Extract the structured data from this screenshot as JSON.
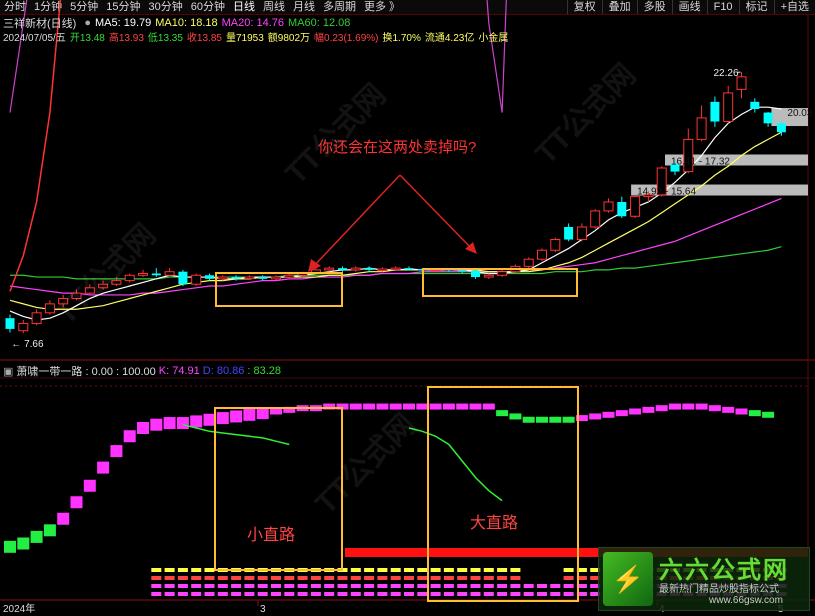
{
  "toolbar": {
    "periods": [
      "分时",
      "1分钟",
      "5分钟",
      "15分钟",
      "30分钟",
      "60分钟",
      "日线",
      "周线",
      "月线",
      "多周期",
      "更多 》"
    ],
    "right_buttons": [
      "复权",
      "叠加",
      "多股",
      "画线",
      "F10",
      "标记",
      "+自选"
    ]
  },
  "main_legend": {
    "title": "三祥新材(日线)",
    "ma5": "MA5: 19.79",
    "ma10": "MA10: 18.18",
    "ma20": "MA20: 14.76",
    "ma60": "MA60: 12.08"
  },
  "info_line": {
    "date": "2024/07/05/五",
    "open": "开13.48",
    "high": "高13.93",
    "low": "低13.35",
    "close": "收13.85",
    "volume": "量71953",
    "amount": "额9802万",
    "change": "幅0.23(1.69%)",
    "turnover": "换1.70%",
    "float_cap": "流通4.23亿",
    "sector": "小金属"
  },
  "price_labels": {
    "high_mark": "22.26",
    "right_mark": "20.03",
    "low_mark": "← 7.66",
    "zone_upper": "16.41 - 17.32",
    "zone_lower": "14.92 - 15.64"
  },
  "annotation": {
    "question": "你还会在这两处卖掉吗?",
    "small_road": "小直路",
    "big_road": "大直路"
  },
  "indicator_legend": {
    "name": "萧啸一带一路 : 0.00 : 100.00",
    "k": "K: 74.91",
    "d": "D: 80.86",
    "j": ": 83.28"
  },
  "x_axis": {
    "year": "2024年",
    "m3": "3",
    "m4": "4",
    "m5": "5"
  },
  "watermark": {
    "logo": "TT公式网",
    "url": "www.66gsw.com",
    "badge_title": "六六公式网",
    "badge_sub": "最新热门精品炒股指标公式",
    "badge_url": "www.66gsw.com"
  },
  "colors": {
    "up": "#ff3333",
    "down": "#00ffff",
    "ma5": "#ffffff",
    "ma10": "#ffff66",
    "ma20": "#ff44ff",
    "ma60": "#33cc33",
    "box": "#ffbb33",
    "arrow": "#dd2222",
    "bar_magenta": "#ff33ff",
    "bar_green": "#22ee44"
  },
  "chart_data": {
    "type": "candlestick",
    "candles": [
      {
        "o": 8.5,
        "c": 7.9,
        "h": 8.7,
        "l": 7.7
      },
      {
        "o": 7.8,
        "c": 8.2,
        "h": 8.4,
        "l": 7.66
      },
      {
        "o": 8.2,
        "c": 8.8,
        "h": 9.0,
        "l": 8.1
      },
      {
        "o": 8.8,
        "c": 9.3,
        "h": 9.5,
        "l": 8.7
      },
      {
        "o": 9.3,
        "c": 9.6,
        "h": 9.8,
        "l": 9.1
      },
      {
        "o": 9.6,
        "c": 9.9,
        "h": 10.1,
        "l": 9.5
      },
      {
        "o": 9.9,
        "c": 10.2,
        "h": 10.4,
        "l": 9.8
      },
      {
        "o": 10.2,
        "c": 10.4,
        "h": 10.6,
        "l": 10.1
      },
      {
        "o": 10.4,
        "c": 10.6,
        "h": 10.8,
        "l": 10.3
      },
      {
        "o": 10.6,
        "c": 10.9,
        "h": 11.0,
        "l": 10.5
      },
      {
        "o": 10.9,
        "c": 11.0,
        "h": 11.2,
        "l": 10.8
      },
      {
        "o": 11.0,
        "c": 10.9,
        "h": 11.3,
        "l": 10.8
      },
      {
        "o": 10.9,
        "c": 11.1,
        "h": 11.3,
        "l": 10.8
      },
      {
        "o": 11.1,
        "c": 10.4,
        "h": 11.2,
        "l": 10.3
      },
      {
        "o": 10.4,
        "c": 10.9,
        "h": 11.0,
        "l": 10.3
      },
      {
        "o": 10.9,
        "c": 10.7,
        "h": 11.0,
        "l": 10.6
      },
      {
        "o": 10.7,
        "c": 10.8,
        "h": 10.9,
        "l": 10.6
      },
      {
        "o": 10.8,
        "c": 10.75,
        "h": 10.9,
        "l": 10.6
      },
      {
        "o": 10.75,
        "c": 10.8,
        "h": 10.9,
        "l": 10.7
      },
      {
        "o": 10.8,
        "c": 10.7,
        "h": 10.9,
        "l": 10.6
      },
      {
        "o": 10.7,
        "c": 10.8,
        "h": 10.9,
        "l": 10.6
      },
      {
        "o": 10.8,
        "c": 10.9,
        "h": 11.0,
        "l": 10.7
      },
      {
        "o": 10.9,
        "c": 11.0,
        "h": 11.1,
        "l": 10.8
      },
      {
        "o": 11.0,
        "c": 11.2,
        "h": 11.3,
        "l": 10.9
      },
      {
        "o": 11.2,
        "c": 11.3,
        "h": 11.4,
        "l": 11.1
      },
      {
        "o": 11.3,
        "c": 11.2,
        "h": 11.4,
        "l": 11.1
      },
      {
        "o": 11.2,
        "c": 11.3,
        "h": 11.4,
        "l": 11.1
      },
      {
        "o": 11.3,
        "c": 11.2,
        "h": 11.4,
        "l": 11.1
      },
      {
        "o": 11.2,
        "c": 11.25,
        "h": 11.35,
        "l": 11.1
      },
      {
        "o": 11.25,
        "c": 11.3,
        "h": 11.4,
        "l": 11.2
      },
      {
        "o": 11.3,
        "c": 11.25,
        "h": 11.4,
        "l": 11.2
      },
      {
        "o": 11.25,
        "c": 11.2,
        "h": 11.3,
        "l": 11.1
      },
      {
        "o": 11.2,
        "c": 11.25,
        "h": 11.3,
        "l": 11.1
      },
      {
        "o": 11.25,
        "c": 11.2,
        "h": 11.3,
        "l": 11.1
      },
      {
        "o": 11.2,
        "c": 11.15,
        "h": 11.3,
        "l": 11.0
      },
      {
        "o": 11.15,
        "c": 10.8,
        "h": 11.2,
        "l": 10.7
      },
      {
        "o": 10.8,
        "c": 10.9,
        "h": 11.0,
        "l": 10.7
      },
      {
        "o": 10.9,
        "c": 11.1,
        "h": 11.2,
        "l": 10.8
      },
      {
        "o": 11.1,
        "c": 11.4,
        "h": 11.5,
        "l": 11.0
      },
      {
        "o": 11.4,
        "c": 11.8,
        "h": 11.9,
        "l": 11.3
      },
      {
        "o": 11.8,
        "c": 12.3,
        "h": 12.4,
        "l": 11.7
      },
      {
        "o": 12.3,
        "c": 12.9,
        "h": 13.0,
        "l": 12.2
      },
      {
        "o": 13.6,
        "c": 12.9,
        "h": 13.8,
        "l": 12.8
      },
      {
        "o": 12.9,
        "c": 13.6,
        "h": 13.8,
        "l": 12.8
      },
      {
        "o": 13.6,
        "c": 14.5,
        "h": 14.6,
        "l": 13.5
      },
      {
        "o": 14.5,
        "c": 15.0,
        "h": 15.2,
        "l": 14.4
      },
      {
        "o": 15.0,
        "c": 14.2,
        "h": 15.3,
        "l": 14.1
      },
      {
        "o": 14.2,
        "c": 15.3,
        "h": 15.4,
        "l": 14.1
      },
      {
        "o": 15.3,
        "c": 15.4,
        "h": 15.6,
        "l": 15.0
      },
      {
        "o": 15.4,
        "c": 16.9,
        "h": 17.0,
        "l": 15.3
      },
      {
        "o": 17.1,
        "c": 16.7,
        "h": 17.32,
        "l": 16.5
      },
      {
        "o": 16.7,
        "c": 18.5,
        "h": 19.1,
        "l": 16.6
      },
      {
        "o": 18.5,
        "c": 19.7,
        "h": 20.4,
        "l": 18.4
      },
      {
        "o": 20.6,
        "c": 19.5,
        "h": 20.9,
        "l": 19.2
      },
      {
        "o": 19.5,
        "c": 21.1,
        "h": 21.5,
        "l": 19.4
      },
      {
        "o": 21.3,
        "c": 22.0,
        "h": 22.26,
        "l": 20.8
      },
      {
        "o": 20.6,
        "c": 20.2,
        "h": 20.8,
        "l": 20.0
      },
      {
        "o": 20.0,
        "c": 19.4,
        "h": 20.03,
        "l": 19.2
      },
      {
        "o": 19.4,
        "c": 18.9,
        "h": 19.5,
        "l": 18.7
      }
    ],
    "ma5": [
      8.9,
      8.6,
      8.4,
      8.5,
      8.8,
      9.2,
      9.6,
      9.9,
      10.1,
      10.3,
      10.5,
      10.7,
      10.9,
      10.8,
      10.8,
      10.8,
      10.7,
      10.7,
      10.8,
      10.8,
      10.8,
      10.8,
      10.9,
      11.0,
      11.1,
      11.2,
      11.2,
      11.3,
      11.2,
      11.2,
      11.25,
      11.2,
      11.2,
      11.2,
      11.2,
      11.1,
      11.0,
      11.0,
      11.1,
      11.2,
      11.6,
      12.0,
      12.4,
      12.9,
      13.4,
      14.0,
      14.4,
      14.7,
      15.0,
      15.5,
      16.1,
      16.8,
      17.6,
      18.6,
      19.4,
      19.9,
      20.3,
      20.3,
      20.2
    ],
    "ma10": [
      9.5,
      9.3,
      9.1,
      9.0,
      9.0,
      9.0,
      9.1,
      9.2,
      9.4,
      9.6,
      9.8,
      10.0,
      10.2,
      10.4,
      10.5,
      10.6,
      10.6,
      10.7,
      10.7,
      10.8,
      10.8,
      10.8,
      10.8,
      10.8,
      10.9,
      10.9,
      11.0,
      11.1,
      11.1,
      11.2,
      11.2,
      11.2,
      11.2,
      11.2,
      11.2,
      11.2,
      11.1,
      11.1,
      11.1,
      11.1,
      11.2,
      11.4,
      11.6,
      11.9,
      12.3,
      12.7,
      13.1,
      13.5,
      13.9,
      14.4,
      14.9,
      15.4,
      15.9,
      16.5,
      17.0,
      17.6,
      18.1,
      18.5,
      18.9
    ],
    "ma20": [
      10.3,
      10.2,
      10.1,
      10.0,
      9.9,
      9.9,
      9.8,
      9.8,
      9.8,
      9.8,
      9.9,
      9.9,
      10.0,
      10.1,
      10.2,
      10.3,
      10.3,
      10.4,
      10.5,
      10.6,
      10.6,
      10.7,
      10.7,
      10.8,
      10.8,
      10.8,
      10.9,
      10.9,
      11.0,
      11.0,
      11.0,
      11.1,
      11.1,
      11.1,
      11.1,
      11.1,
      11.1,
      11.1,
      11.1,
      11.2,
      11.2,
      11.3,
      11.4,
      11.5,
      11.6,
      11.8,
      12.0,
      12.2,
      12.4,
      12.6,
      12.8,
      13.1,
      13.4,
      13.7,
      14.0,
      14.3,
      14.6,
      14.9,
      15.2
    ],
    "ma60": [
      10.9,
      10.9,
      10.8,
      10.8,
      10.8,
      10.7,
      10.7,
      10.7,
      10.7,
      10.7,
      10.7,
      10.7,
      10.8,
      10.8,
      10.8,
      10.8,
      10.8,
      10.8,
      10.8,
      10.8,
      10.8,
      10.9,
      10.9,
      10.9,
      10.9,
      10.9,
      10.9,
      10.9,
      11.0,
      11.0,
      11.0,
      11.0,
      11.0,
      11.0,
      11.0,
      11.0,
      11.0,
      11.0,
      11.0,
      11.0,
      11.0,
      11.1,
      11.1,
      11.1,
      11.2,
      11.2,
      11.3,
      11.3,
      11.4,
      11.5,
      11.6,
      11.7,
      11.8,
      11.9,
      12.0,
      12.1,
      12.2,
      12.3,
      12.5
    ],
    "ylim": [
      7.0,
      23.5
    ],
    "indicator": {
      "bar_levels": [
        8,
        10,
        14,
        18,
        25,
        35,
        45,
        56,
        66,
        75,
        80,
        82,
        83,
        83,
        84,
        85,
        86,
        87,
        88,
        89,
        90,
        91,
        92,
        92,
        93,
        93,
        93,
        93,
        93,
        93,
        93,
        93,
        93,
        93,
        93,
        93,
        93,
        89,
        87,
        85,
        85,
        85,
        85,
        86,
        87,
        88,
        89,
        90,
        91,
        92,
        93,
        93,
        93,
        92,
        91,
        90,
        89,
        88
      ],
      "bar_color": [
        "g",
        "g",
        "g",
        "g",
        "m",
        "m",
        "m",
        "m",
        "m",
        "m",
        "m",
        "m",
        "m",
        "m",
        "m",
        "m",
        "m",
        "m",
        "m",
        "m",
        "m",
        "m",
        "m",
        "m",
        "m",
        "m",
        "m",
        "m",
        "m",
        "m",
        "m",
        "m",
        "m",
        "m",
        "m",
        "m",
        "m",
        "g",
        "g",
        "g",
        "g",
        "g",
        "g",
        "m",
        "m",
        "m",
        "m",
        "m",
        "m",
        "m",
        "m",
        "m",
        "m",
        "m",
        "m",
        "m",
        "g",
        "g"
      ],
      "red_line": [
        10,
        12,
        15,
        20,
        28,
        38,
        48,
        58,
        68,
        75,
        78,
        80,
        80,
        81,
        82,
        83,
        84,
        85,
        86,
        87,
        86,
        85,
        84,
        82,
        83,
        84,
        85,
        84,
        83,
        80,
        78,
        76,
        75,
        76,
        78,
        80,
        82,
        84,
        86,
        88,
        90,
        91,
        92,
        92,
        92,
        92,
        92,
        92,
        92,
        92,
        91,
        90,
        89,
        88,
        87,
        86,
        85,
        84
      ],
      "magenta_line": [
        20,
        25,
        30,
        40,
        55,
        65,
        72,
        78,
        82,
        84,
        84,
        82,
        80,
        74,
        72,
        68,
        70,
        72,
        73,
        72,
        70,
        65,
        60,
        50,
        55,
        60,
        70,
        80,
        83,
        84,
        82,
        80,
        70,
        60,
        45,
        35,
        25,
        20,
        40,
        55,
        65,
        75,
        85,
        90,
        92,
        95,
        93,
        90,
        88,
        92,
        95,
        93,
        90,
        80,
        75,
        70,
        70,
        68
      ],
      "green_line": [
        null,
        null,
        null,
        null,
        null,
        null,
        null,
        null,
        null,
        null,
        null,
        null,
        null,
        82,
        80,
        78,
        77,
        76,
        75,
        74,
        72,
        70,
        null,
        null,
        null,
        null,
        null,
        null,
        null,
        null,
        80,
        78,
        75,
        70,
        60,
        50,
        42,
        36,
        null,
        null,
        null,
        null,
        null,
        null,
        null,
        null,
        null,
        null,
        null,
        null,
        null,
        null,
        null,
        null,
        null,
        null,
        null,
        null
      ],
      "ylim": [
        0,
        100
      ]
    }
  }
}
